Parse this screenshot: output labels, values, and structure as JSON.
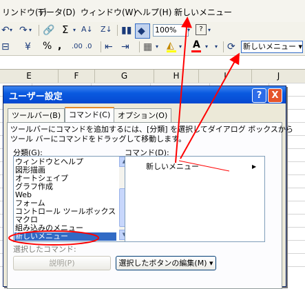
{
  "menubar": {
    "items": [
      "リンドウ(T)",
      "データ(D)",
      "ウィンドウ(W)",
      "ヘルプ(H)",
      "新しいメニュー"
    ]
  },
  "toolbar": {
    "zoom": "100%",
    "new_menu_button": "新しいメニュー"
  },
  "columns": [
    "E",
    "F",
    "G",
    "H",
    "I",
    "J"
  ],
  "dialog": {
    "title": "ユーザー設定",
    "help_button": "?",
    "close_button": "X",
    "tabs": [
      "ツールバー(B)",
      "コマンド(C)",
      "オプション(O)"
    ],
    "description_line1": "ツールバーにコマンドを追加するには、[分類] を選択してダイアログ ボックスから",
    "description_line2": "ツール バーにコマンドをドラッグして移動します。",
    "categories_label": "分類(G):",
    "commands_label": "コマンド(D):",
    "categories": [
      "ウィンドウとヘルプ",
      "図形描画",
      "オートシェイプ",
      "グラフ作成",
      "Web",
      "フォーム",
      "コントロール ツールボックス",
      "マクロ",
      "組み込みのメニュー",
      "新しいメニュー"
    ],
    "selected_category": "新しいメニュー",
    "command_item": "新しいメニュー",
    "selected_command_label": "選択したコマンド:",
    "description_button": "説明(P)",
    "modify_selection_button": "選択したボタンの編集(M)"
  },
  "colors": {
    "annotation": "#ff0000",
    "title_bar": "#0a5ae0",
    "selection": "#316ac5"
  }
}
